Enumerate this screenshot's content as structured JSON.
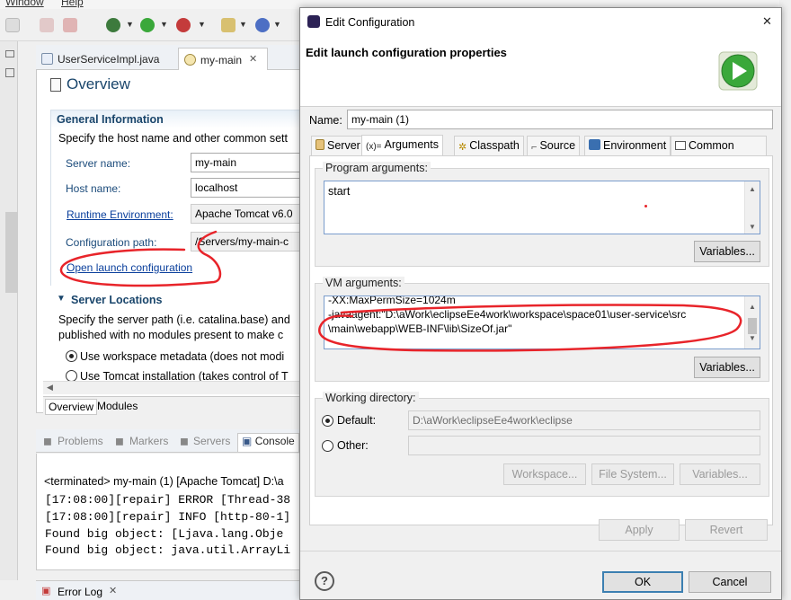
{
  "menubar": {
    "items": [
      "Window",
      "Help"
    ]
  },
  "editor": {
    "tabs": [
      "UserServiceImpl.java",
      "my-main"
    ],
    "overview_title": "Overview",
    "general": {
      "heading": "General Information",
      "description": "Specify the host name and other common sett",
      "server_name_label": "Server name:",
      "server_name_value": "my-main",
      "host_name_label": "Host name:",
      "host_name_value": "localhost",
      "runtime_label": "Runtime Environment:",
      "runtime_value": "Apache Tomcat v6.0",
      "config_path_label": "Configuration path:",
      "config_path_value": "/Servers/my-main-c",
      "open_launch_link": "Open launch configuration"
    },
    "locations": {
      "heading": "Server Locations",
      "desc_line1": "Specify the server path (i.e. catalina.base) and",
      "desc_line2": "published with no modules present to make c",
      "option1": "Use workspace metadata (does not modi",
      "option2": "Use Tomcat installation (takes control of T"
    },
    "bottom_tabs": [
      "Overview",
      "Modules"
    ]
  },
  "console": {
    "tabs": [
      "Problems",
      "Markers",
      "Servers",
      "Console"
    ],
    "terminated": "<terminated> my-main (1) [Apache Tomcat] D:\\a",
    "lines": [
      "[17:08:00][repair] ERROR [Thread-38",
      "[17:08:00][repair] INFO [http-80-1]",
      "Found big object:   [Ljava.lang.Obje",
      "Found big object:   java.util.ArrayLi"
    ],
    "error_log_tab": "Error Log"
  },
  "dialog": {
    "title": "Edit Configuration",
    "subtitle": "Edit launch configuration properties",
    "name_label": "Name:",
    "name_value": "my-main (1)",
    "tabs": [
      "Server",
      "Arguments",
      "Classpath",
      "Source",
      "Environment",
      "Common"
    ],
    "program_args_label": "Program arguments:",
    "program_args_value": "start",
    "vm_args_label": "VM arguments:",
    "vm_args_lines": [
      "-XX:MaxPermSize=1024m",
      "-javaagent:\"D:\\aWork\\eclipseEe4work\\workspace\\space01\\user-service\\src",
      "\\main\\webapp\\WEB-INF\\lib\\SizeOf.jar\""
    ],
    "variables_label": "Variables...",
    "working_dir_label": "Working directory:",
    "default_label": "Default:",
    "default_value": "D:\\aWork\\eclipseEe4work\\eclipse",
    "other_label": "Other:",
    "workspace_button": "Workspace...",
    "filesystem_button": "File System...",
    "apply_button": "Apply",
    "revert_button": "Revert",
    "ok_button": "OK",
    "cancel_button": "Cancel",
    "help_icon": "?",
    "close_icon": "✕"
  },
  "colors": {
    "annotation": "#e8242a",
    "link": "#0a3f9c",
    "section_heading": "#19456b",
    "run_green": "#3aa83a"
  }
}
